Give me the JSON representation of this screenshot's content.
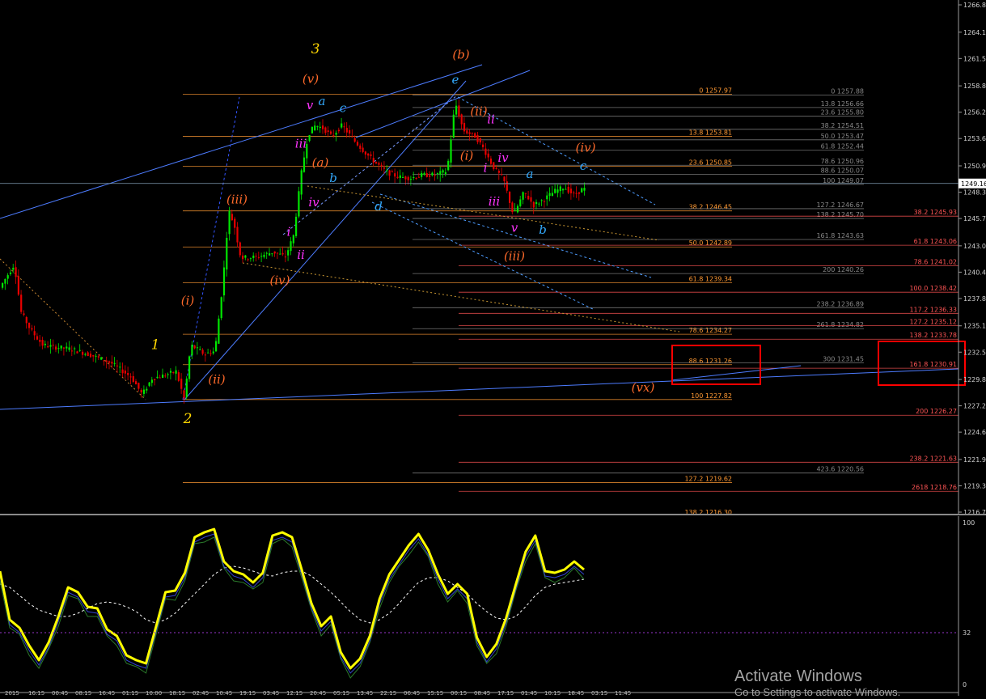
{
  "chart_data": [
    {
      "type": "candlestick",
      "title": "",
      "ylim": [
        1216.7,
        1266.8
      ],
      "price_axis_labels": [
        "1266.80",
        "1264.10",
        "1261.50",
        "1258.80",
        "1256.20",
        "1253.60",
        "1250.90",
        "1248.30",
        "1245.70",
        "1243.00",
        "1240.40",
        "1237.80",
        "1235.10",
        "1232.50",
        "1229.80",
        "1227.20",
        "1224.60",
        "1221.90",
        "1219.30",
        "1216.70"
      ],
      "current_price": "1249.16",
      "close_path": [
        [
          0,
          1238.6
        ],
        [
          20,
          1241.2
        ],
        [
          28,
          1236.5
        ],
        [
          40,
          1234.7
        ],
        [
          55,
          1233.2
        ],
        [
          70,
          1233.0
        ],
        [
          90,
          1232.8
        ],
        [
          115,
          1232.2
        ],
        [
          140,
          1231.4
        ],
        [
          165,
          1230.0
        ],
        [
          178,
          1228.3
        ],
        [
          190,
          1229.9
        ],
        [
          205,
          1230.2
        ],
        [
          220,
          1230.6
        ],
        [
          230,
          1227.8
        ],
        [
          238,
          1233.2
        ],
        [
          255,
          1232.3
        ],
        [
          268,
          1232.6
        ],
        [
          278,
          1239.6
        ],
        [
          285,
          1246.5
        ],
        [
          292,
          1245.0
        ],
        [
          300,
          1241.8
        ],
        [
          320,
          1241.9
        ],
        [
          340,
          1242.4
        ],
        [
          355,
          1241.9
        ],
        [
          365,
          1244.0
        ],
        [
          375,
          1250.3
        ],
        [
          383,
          1254.0
        ],
        [
          392,
          1254.9
        ],
        [
          402,
          1254.6
        ],
        [
          412,
          1253.8
        ],
        [
          425,
          1254.9
        ],
        [
          440,
          1253.4
        ],
        [
          455,
          1252.1
        ],
        [
          465,
          1251.3
        ],
        [
          480,
          1250.3
        ],
        [
          495,
          1249.8
        ],
        [
          510,
          1249.7
        ],
        [
          525,
          1250.0
        ],
        [
          540,
          1250.0
        ],
        [
          555,
          1250.4
        ],
        [
          565,
          1257.2
        ],
        [
          575,
          1254.4
        ],
        [
          590,
          1253.8
        ],
        [
          600,
          1252.6
        ],
        [
          612,
          1250.8
        ],
        [
          625,
          1249.5
        ],
        [
          637,
          1246.0
        ],
        [
          650,
          1248.3
        ],
        [
          662,
          1247.0
        ],
        [
          675,
          1247.6
        ],
        [
          688,
          1248.4
        ],
        [
          700,
          1248.8
        ],
        [
          712,
          1248.0
        ],
        [
          722,
          1248.6
        ]
      ],
      "fib_levels_left": [
        {
          "label": "0 1257.97",
          "value": 1257.97
        },
        {
          "label": "13.8 1253.81",
          "value": 1253.81
        },
        {
          "label": "23.6 1250.85",
          "value": 1250.85
        },
        {
          "label": "38.2 1246.45",
          "value": 1246.45
        },
        {
          "label": "50.0 1242.89",
          "value": 1242.89
        },
        {
          "label": "61.8 1239.34",
          "value": 1239.34
        },
        {
          "label": "78.6 1234.27",
          "value": 1234.27
        },
        {
          "label": "88.6 1231.26",
          "value": 1231.26
        },
        {
          "label": "100 1227.82",
          "value": 1227.82
        },
        {
          "label": "127.2 1219.62",
          "value": 1219.62
        },
        {
          "label": "138.2 1216.30",
          "value": 1216.3
        }
      ],
      "fib_levels_mid": [
        {
          "label": "0 1257.88",
          "value": 1257.88
        },
        {
          "label": "13.8 1256.66",
          "value": 1256.66
        },
        {
          "label": "23.6 1255.80",
          "value": 1255.8
        },
        {
          "label": "38.2 1254.51",
          "value": 1254.51
        },
        {
          "label": "50.0 1253.47",
          "value": 1253.47
        },
        {
          "label": "61.8 1252.44",
          "value": 1252.44
        },
        {
          "label": "78.6 1250.96",
          "value": 1250.96
        },
        {
          "label": "88.6 1250.07",
          "value": 1250.07
        },
        {
          "label": "100 1249.07",
          "value": 1249.07
        },
        {
          "label": "127.2 1246.67",
          "value": 1246.67
        },
        {
          "label": "138.2 1245.70",
          "value": 1245.7
        },
        {
          "label": "161.8 1243.63",
          "value": 1243.63
        },
        {
          "label": "200 1240.26",
          "value": 1240.26
        },
        {
          "label": "238.2 1236.89",
          "value": 1236.89
        },
        {
          "label": "261.8 1234.82",
          "value": 1234.82
        },
        {
          "label": "300 1231.45",
          "value": 1231.45
        },
        {
          "label": "423.6 1220.56",
          "value": 1220.56
        }
      ],
      "fib_levels_right": [
        {
          "label": "38.2 1245.93",
          "value": 1245.93
        },
        {
          "label": "61.8 1243.06",
          "value": 1243.06
        },
        {
          "label": "78.6 1241.02",
          "value": 1241.02
        },
        {
          "label": "100.0 1238.42",
          "value": 1238.42
        },
        {
          "label": "117.2 1236.33",
          "value": 1236.33
        },
        {
          "label": "127.2 1235.12",
          "value": 1235.12
        },
        {
          "label": "138.2 1233.78",
          "value": 1233.78
        },
        {
          "label": "161.8 1230.91",
          "value": 1230.91
        },
        {
          "label": "200 1226.27",
          "value": 1226.27
        },
        {
          "label": "238.2 1221.63",
          "value": 1221.63
        },
        {
          "label": "2618 1218.76",
          "value": 1218.76
        }
      ],
      "wave_labels": [
        {
          "text": "3",
          "color": "#ffd700",
          "bar": 390,
          "price": 1262.0
        },
        {
          "text": "(v)",
          "color": "#ff6a2a",
          "bar": 384,
          "price": 1259.1
        },
        {
          "text": "v",
          "color": "#ff33ff",
          "bar": 383,
          "price": 1256.5
        },
        {
          "text": "a",
          "color": "#33aaff",
          "bar": 398,
          "price": 1256.9
        },
        {
          "text": "c",
          "color": "#33aaff",
          "bar": 424,
          "price": 1256.2
        },
        {
          "text": "iii",
          "color": "#ff33ff",
          "bar": 372,
          "price": 1252.7
        },
        {
          "text": "(a)",
          "color": "#ff6a2a",
          "bar": 396,
          "price": 1250.8
        },
        {
          "text": "b",
          "color": "#33aaff",
          "bar": 412,
          "price": 1249.3
        },
        {
          "text": "iv",
          "color": "#ff33ff",
          "bar": 388,
          "price": 1246.9
        },
        {
          "text": "d",
          "color": "#33aaff",
          "bar": 468,
          "price": 1246.5
        },
        {
          "text": "(iii)",
          "color": "#ff6a2a",
          "bar": 293,
          "price": 1247.2
        },
        {
          "text": "i",
          "color": "#ff33ff",
          "bar": 357,
          "price": 1244.0
        },
        {
          "text": "ii",
          "color": "#ff33ff",
          "bar": 372,
          "price": 1241.7
        },
        {
          "text": "(iv)",
          "color": "#ff6a2a",
          "bar": 346,
          "price": 1239.2
        },
        {
          "text": "(i)",
          "color": "#ff6a2a",
          "bar": 232,
          "price": 1237.2
        },
        {
          "text": "1",
          "color": "#ffd700",
          "bar": 192,
          "price": 1232.8
        },
        {
          "text": "(ii)",
          "color": "#ff6a2a",
          "bar": 268,
          "price": 1229.4
        },
        {
          "text": "2",
          "color": "#ffd700",
          "bar": 232,
          "price": 1225.5
        },
        {
          "text": "(b)",
          "color": "#ff6a2a",
          "bar": 570,
          "price": 1261.5
        },
        {
          "text": "e",
          "color": "#33aaff",
          "bar": 563,
          "price": 1259.0
        },
        {
          "text": "(ii)",
          "color": "#ff6a2a",
          "bar": 592,
          "price": 1255.9
        },
        {
          "text": "ii",
          "color": "#ff33ff",
          "bar": 607,
          "price": 1255.1
        },
        {
          "text": "(i)",
          "color": "#ff6a2a",
          "bar": 577,
          "price": 1251.5
        },
        {
          "text": "i",
          "color": "#ff33ff",
          "bar": 600,
          "price": 1250.3
        },
        {
          "text": "iv",
          "color": "#ff33ff",
          "bar": 622,
          "price": 1251.3
        },
        {
          "text": "iii",
          "color": "#ff33ff",
          "bar": 611,
          "price": 1247.0
        },
        {
          "text": "a",
          "color": "#33aaff",
          "bar": 655,
          "price": 1249.7
        },
        {
          "text": "v",
          "color": "#ff33ff",
          "bar": 636,
          "price": 1244.4
        },
        {
          "text": "b",
          "color": "#33aaff",
          "bar": 671,
          "price": 1244.2
        },
        {
          "text": "(iii)",
          "color": "#ff6a2a",
          "bar": 636,
          "price": 1241.6
        },
        {
          "text": "(iv)",
          "color": "#ff6a2a",
          "bar": 724,
          "price": 1252.3
        },
        {
          "text": "c",
          "color": "#33aaff",
          "bar": 721,
          "price": 1250.5
        },
        {
          "text": "(vx)",
          "color": "#ff6a2a",
          "bar": 795,
          "price": 1228.6
        }
      ],
      "time_axis_labels": [
        "18 Jun 2015",
        "18 Jun 16:15",
        "19 Jun 00:45",
        "19 Jun 08:15",
        "19 Jun 16:45",
        "22 Jun 01:15",
        "22 Jun 10:00",
        "22 Jun 18:15",
        "23 Jun 02:45",
        "23 Jun 10:45",
        "23 Jun 19:15",
        "24 Jun 03:45",
        "24 Jun 12:15",
        "24 Jun 20:45",
        "25 Jun 05:15",
        "25 Jun 13:45",
        "25 Jun 22:15",
        "26 Jun 06:45",
        "26 Jun 15:15",
        "29 Jun 00:15",
        "29 Jun 08:45",
        "29 Jun 17:15",
        "30 Jun 01:45",
        "30 Jun 10:15",
        "30 Jun 18:45",
        "1 Jul 03:15",
        "1 Jul 11:45"
      ],
      "colors": {
        "up": "#00e600",
        "down": "#e60000",
        "fib_left": "#ff9933",
        "fib_mid": "#888888",
        "fib_right": "#ff5555",
        "channel": "#4d7cff",
        "highlight_box": "#ff0000"
      }
    },
    {
      "type": "line",
      "title": "",
      "ylim": [
        0,
        100
      ],
      "axis_labels": [
        "100",
        "32",
        "0"
      ],
      "main_line_color": "#ffff00",
      "main_line": [
        70,
        40,
        35,
        24,
        15,
        26,
        42,
        60,
        57,
        48,
        47,
        34,
        30,
        18,
        15,
        13,
        35,
        57,
        58,
        69,
        91,
        94,
        96,
        76,
        70,
        68,
        63,
        69,
        92,
        94,
        91,
        71,
        50,
        36,
        42,
        20,
        10,
        16,
        30,
        53,
        68,
        77,
        86,
        93,
        83,
        68,
        56,
        62,
        56,
        29,
        17,
        25,
        41,
        62,
        82,
        92,
        70,
        69,
        71,
        76,
        71
      ],
      "signal_line_color": "#ffffff",
      "signal_line": [
        62,
        60,
        55,
        50,
        46,
        44,
        42,
        42,
        44,
        47,
        50,
        51,
        50,
        48,
        45,
        40,
        38,
        40,
        44,
        50,
        56,
        62,
        68,
        72,
        73,
        72,
        70,
        68,
        67,
        69,
        70,
        70,
        67,
        62,
        57,
        51,
        45,
        40,
        38,
        40,
        44,
        50,
        57,
        63,
        66,
        66,
        64,
        60,
        56,
        50,
        45,
        41,
        40,
        42,
        48,
        55,
        60,
        62,
        63,
        64,
        65
      ]
    }
  ],
  "watermark": {
    "title": "Activate Windows",
    "subtitle": "Go to Settings to activate Windows."
  }
}
